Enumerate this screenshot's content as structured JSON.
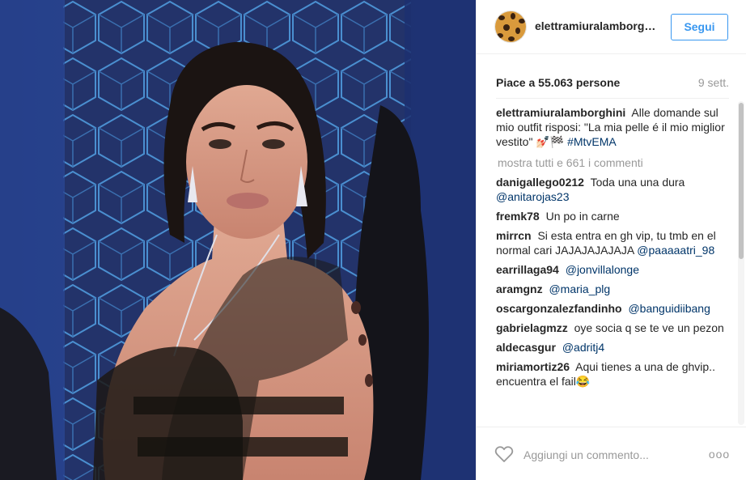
{
  "post": {
    "username": "elettramiuralamborg…",
    "follow_label": "Segui",
    "likes": "Piace a 55.063 persone",
    "time": "9 sett.",
    "caption": {
      "author": "elettramiuralamborghini",
      "text": "Alle domande sul mio outfit risposi: \"La mia pelle é il mio miglior vestito\" 💅🏻🏁",
      "hashtag": "#MtvEMA"
    },
    "load_more": "mostra tutti e 661 i commenti"
  },
  "comments": [
    {
      "author": "danigallego0212",
      "text": "Toda una una dura",
      "mention": "@anitarojas23"
    },
    {
      "author": "fremk78",
      "text": "Un po in carne",
      "mention": ""
    },
    {
      "author": "mirrcn",
      "text": "Si esta entra en gh vip, tu tmb en el normal cari JAJAJAJAJAJA",
      "mention": "@paaaaatri_98"
    },
    {
      "author": "earrillaga94",
      "text": "",
      "mention": "@jonvillalonge"
    },
    {
      "author": "aramgnz",
      "text": "",
      "mention": "@maria_plg"
    },
    {
      "author": "oscargonzalezfandinho",
      "text": "",
      "mention": "@banguidiibang"
    },
    {
      "author": "gabrielagmzz",
      "text": "oye socia q se te ve un pezon",
      "mention": ""
    },
    {
      "author": "aldecasgur",
      "text": "",
      "mention": "@adritj4"
    },
    {
      "author": "miriamortiz26",
      "text": "Aqui tienes a una de ghvip.. encuentra el fail😂",
      "mention": ""
    }
  ],
  "footer": {
    "add_comment_placeholder": "Aggiungi un commento...",
    "more_label": "ooo"
  },
  "icons": {
    "heart": "heart-outline-icon",
    "more": "ellipsis-icon",
    "avatar": "leopard-print-avatar"
  },
  "colors": {
    "accent": "#3897f0",
    "text": "#262626",
    "muted": "#999999",
    "mention": "#003569",
    "photo_bg": "#1f2b57"
  }
}
